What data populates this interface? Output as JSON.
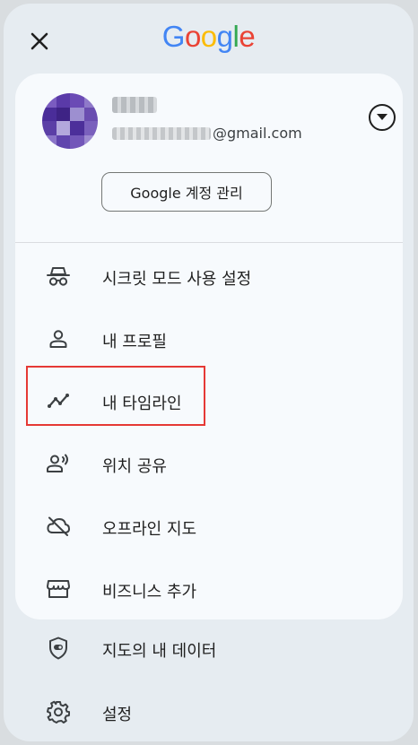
{
  "header": {
    "close_icon": "close-icon",
    "logo_letters": [
      {
        "ch": "G",
        "color": "#4285F4"
      },
      {
        "ch": "o",
        "color": "#EA4335"
      },
      {
        "ch": "o",
        "color": "#FBBC05"
      },
      {
        "ch": "g",
        "color": "#4285F4"
      },
      {
        "ch": "l",
        "color": "#34A853"
      },
      {
        "ch": "e",
        "color": "#EA4335"
      }
    ]
  },
  "account": {
    "email_suffix": "@gmail.com",
    "manage_label": "Google 계정 관리",
    "toggle_icon": "dropdown-arrow-icon"
  },
  "menu_card": [
    {
      "label": "시크릿 모드 사용 설정",
      "icon": "incognito-icon"
    },
    {
      "label": "내 프로필",
      "icon": "person-icon"
    },
    {
      "label": "내 타임라인",
      "icon": "timeline-icon"
    },
    {
      "label": "위치 공유",
      "icon": "location-sharing-icon"
    },
    {
      "label": "오프라인 지도",
      "icon": "offline-maps-icon"
    },
    {
      "label": "비즈니스 추가",
      "icon": "storefront-icon"
    }
  ],
  "menu_bottom": [
    {
      "label": "지도의 내 데이터",
      "icon": "shield-data-icon"
    },
    {
      "label": "설정",
      "icon": "gear-icon"
    }
  ],
  "colors": {
    "highlight": "#e53935",
    "sheet_bg": "#e6ecf1",
    "card_bg": "#f7fafd"
  }
}
